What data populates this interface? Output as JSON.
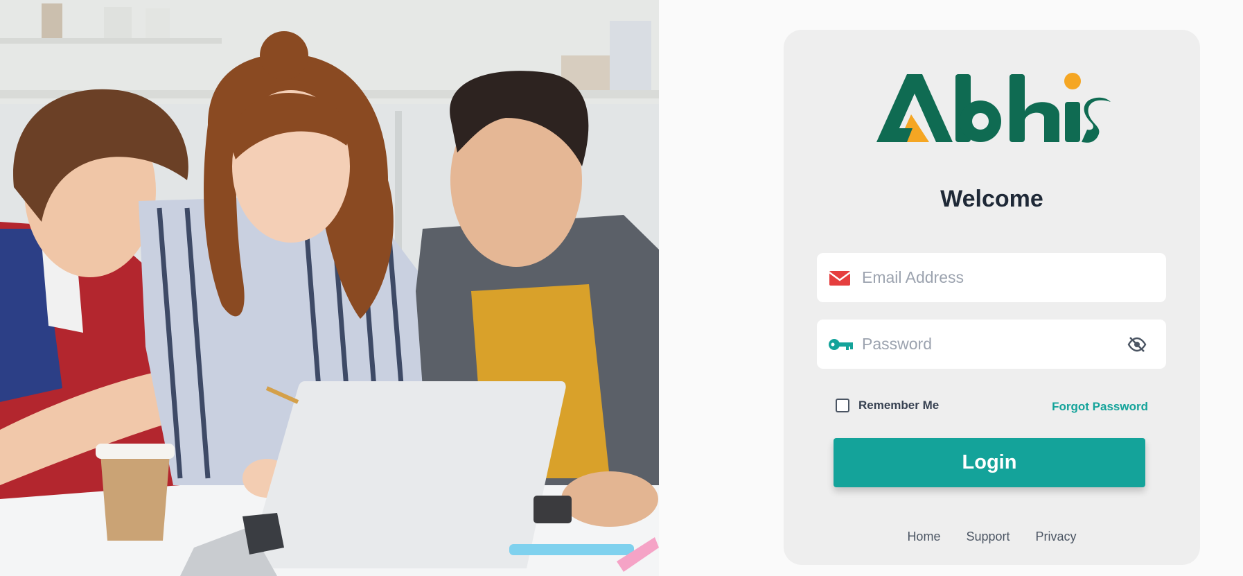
{
  "brand": {
    "logo_text": "Abhis",
    "primary_color": "#0f6b52",
    "accent_color": "#f5a623"
  },
  "hero_image": {
    "icon": "students-with-laptop-photo"
  },
  "login": {
    "heading": "Welcome",
    "email": {
      "placeholder": "Email Address",
      "value": "",
      "icon": "envelope-icon",
      "icon_color": "#e53e3e"
    },
    "password": {
      "placeholder": "Password",
      "value": "",
      "icon": "key-icon",
      "icon_color": "#14a39a",
      "toggle_icon": "eye-slash-icon"
    },
    "remember_me": {
      "label": "Remember Me",
      "checked": false
    },
    "forgot_password_label": "Forgot Password",
    "submit_label": "Login",
    "accent_color": "#14a39a"
  },
  "footer": {
    "links": [
      "Home",
      "Support",
      "Privacy"
    ]
  }
}
